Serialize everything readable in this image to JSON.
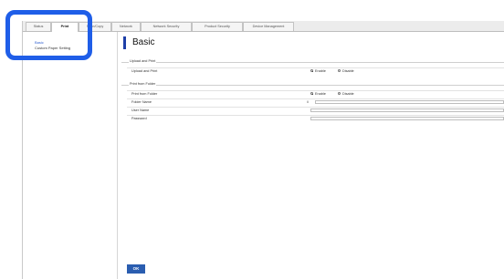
{
  "tabs": [
    {
      "label": "Status"
    },
    {
      "label": "Print"
    },
    {
      "label": "Scan/Copy"
    },
    {
      "label": "Network"
    },
    {
      "label": "Network Security"
    },
    {
      "label": "Product Security"
    },
    {
      "label": "Device Management"
    }
  ],
  "sidebar": {
    "items": [
      {
        "label": "Basic"
      },
      {
        "label": "Custom Paper Setting"
      }
    ]
  },
  "page": {
    "title": "Basic"
  },
  "upload_section": {
    "legend": "Upload and Print",
    "row_label": "Upload and Print",
    "enable_label": "Enable",
    "disable_label": "Disable",
    "selected": "Enable"
  },
  "folder_section": {
    "legend": "Print from Folder",
    "rows": [
      {
        "label": "Print from Folder",
        "enable_label": "Enable",
        "disable_label": "Disable",
        "selected": "Enable"
      },
      {
        "label": "Folder Name",
        "value": "\\\\"
      },
      {
        "label": "User Name",
        "value": ""
      },
      {
        "label": "Password",
        "value": ""
      }
    ]
  },
  "ok_button": {
    "label": "OK"
  },
  "colors": {
    "accent": "#2a5db0",
    "highlight": "#1f5ee8",
    "title_bar": "#1e3fa8"
  }
}
